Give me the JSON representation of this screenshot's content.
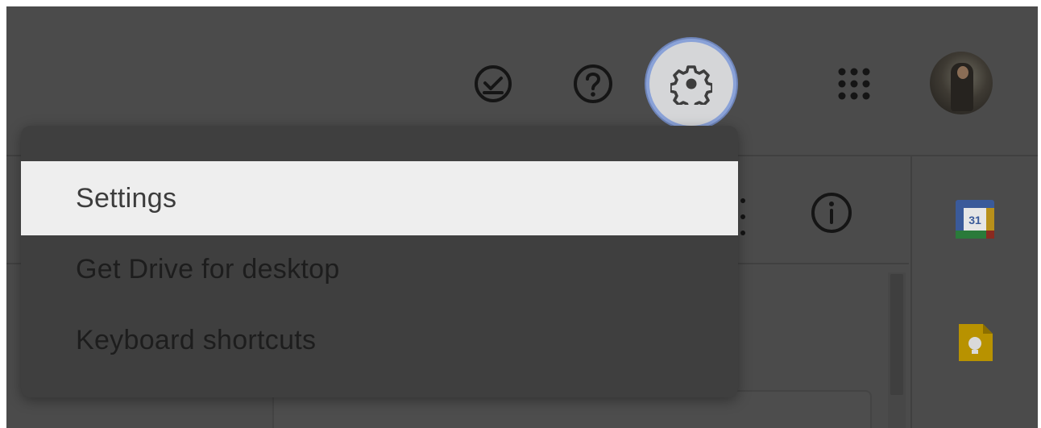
{
  "header": {
    "icons": [
      "ready-for-offline-icon",
      "help-icon",
      "settings-gear-icon",
      "google-apps-icon",
      "account-avatar"
    ]
  },
  "toolbar": {
    "icons": [
      "more-vert-icon",
      "info-icon"
    ]
  },
  "side_panel": {
    "apps": [
      {
        "name": "calendar",
        "label": "31"
      },
      {
        "name": "keep",
        "label": ""
      }
    ]
  },
  "settings_menu": {
    "items": [
      {
        "label": "Settings",
        "highlighted": true
      },
      {
        "label": "Get Drive for desktop",
        "highlighted": false
      },
      {
        "label": "Keyboard shortcuts",
        "highlighted": false
      }
    ]
  },
  "colors": {
    "backdrop": "#4b4b4b",
    "menu": "#3f3f3f",
    "menu_highlight": "#eeeeee",
    "focus_ring": "#8aa2d8",
    "calendar_blue": "#4285f4",
    "calendar_green": "#34a853",
    "calendar_yellow": "#fbbc04",
    "keep_yellow": "#e0b000"
  }
}
